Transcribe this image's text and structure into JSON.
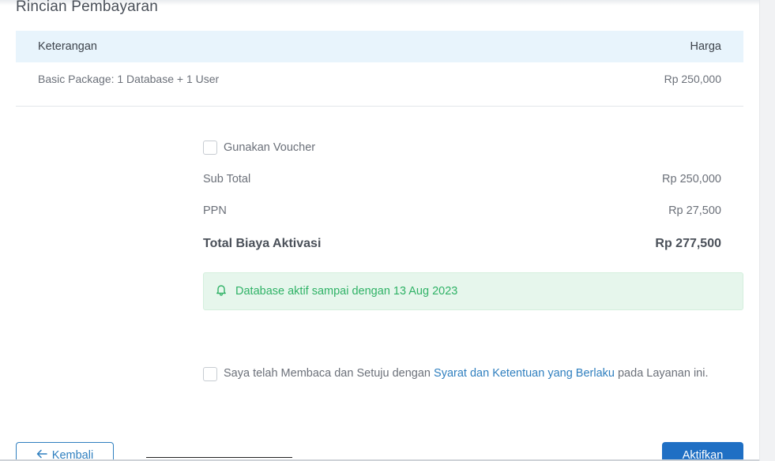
{
  "section": {
    "title": "Rincian Pembayaran"
  },
  "table": {
    "header_desc": "Keterangan",
    "header_price": "Harga",
    "rows": [
      {
        "desc": "Basic Package: 1 Database + 1 User",
        "price": "Rp 250,000"
      }
    ]
  },
  "voucher": {
    "label": "Gunakan Voucher",
    "checked": false
  },
  "summary": {
    "subtotal_label": "Sub Total",
    "subtotal_value": "Rp 250,000",
    "ppn_label": "PPN",
    "ppn_value": "Rp 27,500",
    "total_label": "Total Biaya Aktivasi",
    "total_value": "Rp 277,500"
  },
  "notice": {
    "icon": "bell-icon",
    "text": "Database aktif sampai dengan 13 Aug 2023",
    "color": "#2fb266"
  },
  "agreement": {
    "checked": false,
    "text_before": "Saya telah Membaca dan Setuju dengan ",
    "link_text": "Syarat dan Ketentuan yang Berlaku",
    "text_after": " pada Layanan ini."
  },
  "buttons": {
    "back_label": "Kembali",
    "back_icon": "arrow-left-icon",
    "activate_label": "Aktifkan",
    "accent": "#1f6fc4"
  }
}
